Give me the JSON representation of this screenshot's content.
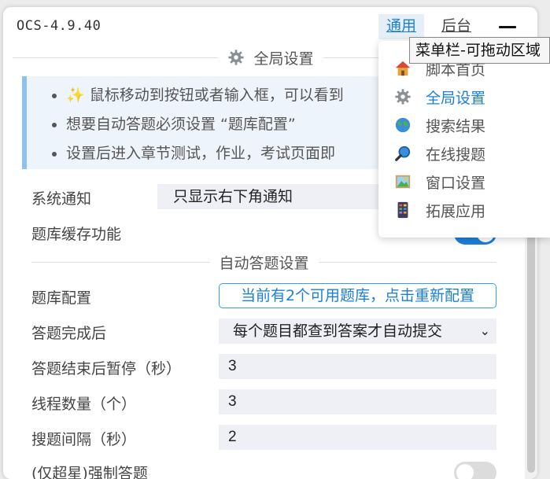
{
  "header": {
    "app_title": "OCS-4.9.40",
    "tabs": [
      {
        "label": "通用",
        "active": true
      },
      {
        "label": "后台",
        "active": false
      }
    ]
  },
  "global_settings": {
    "title": "全局设置",
    "notices": [
      "✨ 鼠标移动到按钮或者输入框，可以看到",
      "想要自动答题必须设置 “题库配置”",
      "设置后进入章节测试，作业，考试页面即"
    ],
    "system_notice": {
      "label": "系统通知",
      "value": "只显示右下角通知"
    },
    "cache": {
      "label": "题库缓存功能",
      "enabled": true
    }
  },
  "auto_answer": {
    "title": "自动答题设置",
    "question_bank": {
      "label": "题库配置",
      "button": "当前有2个可用题库，点击重新配置"
    },
    "after_answer": {
      "label": "答题完成后",
      "value": "每个题目都查到答案才自动提交"
    },
    "pause": {
      "label": "答题结束后暂停（秒）",
      "value": "3"
    },
    "threads": {
      "label": "线程数量（个）",
      "value": "3"
    },
    "interval": {
      "label": "搜题间隔（秒）",
      "value": "2"
    },
    "force_answer": {
      "label": "(仅超星)强制答题",
      "enabled": false
    }
  },
  "menu": {
    "tooltip": "菜单栏-可拖动区域",
    "items": [
      {
        "label": "脚本首页",
        "icon": "house-icon",
        "active": false
      },
      {
        "label": "全局设置",
        "icon": "gear-icon",
        "active": true
      },
      {
        "label": "搜索结果",
        "icon": "globe-icon",
        "active": false
      },
      {
        "label": "在线搜题",
        "icon": "magnifier-icon",
        "active": false
      },
      {
        "label": "窗口设置",
        "icon": "picture-icon",
        "active": false
      },
      {
        "label": "拓展应用",
        "icon": "app-grid-icon",
        "active": false
      }
    ]
  },
  "colors": {
    "accent": "#1c7fd6",
    "notice_bg": "#eef4fb",
    "field_bg": "#eef0f5"
  }
}
